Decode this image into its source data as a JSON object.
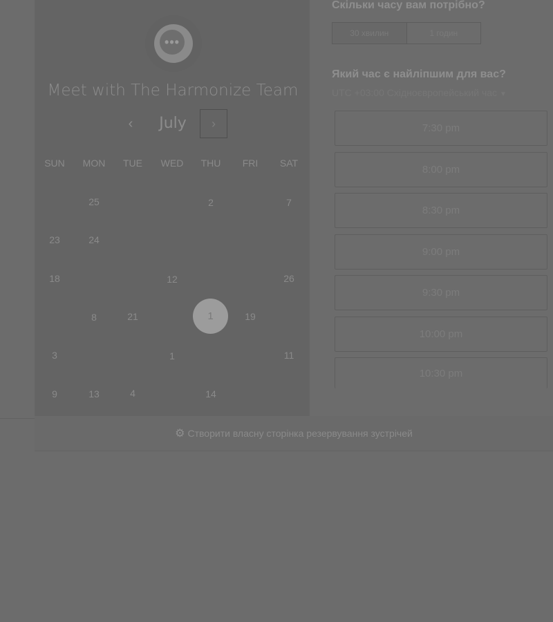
{
  "calendar": {
    "team_title": "Meet with The Harmonize Team",
    "month": "July",
    "prev_icon": "chevron-left-icon",
    "next_icon": "chevron-right-icon",
    "weekdays": [
      "SUN",
      "MON",
      "TUE",
      "WED",
      "THU",
      "FRI",
      "SAT"
    ],
    "days": [
      "25",
      "2",
      "7",
      "23",
      "24",
      "18",
      "12",
      "26",
      "8",
      "21",
      "19",
      "3",
      "1",
      "11",
      "9",
      "13",
      "4",
      "14"
    ],
    "selected_day": "1"
  },
  "duration": {
    "title": "Скільки часу вам потрібно?",
    "options": [
      "30 хвилин",
      "1 годин"
    ]
  },
  "time": {
    "title": "Який час є найліпшим для вас?",
    "timezone": "UTC +03:00 Східноєвропейський час",
    "slots": [
      "7:30 pm",
      "8:00 pm",
      "8:30 pm",
      "9:00 pm",
      "9:30 pm",
      "10:00 pm",
      "10:30 pm"
    ]
  },
  "footer": {
    "link_text": "Створити власну сторінка резервування зустрічей",
    "icon": "sprocket-icon"
  },
  "colors": {
    "overlay_background": "#6c6c6c",
    "panel_background": "#646464",
    "selected_day": "#9c9c9c"
  }
}
